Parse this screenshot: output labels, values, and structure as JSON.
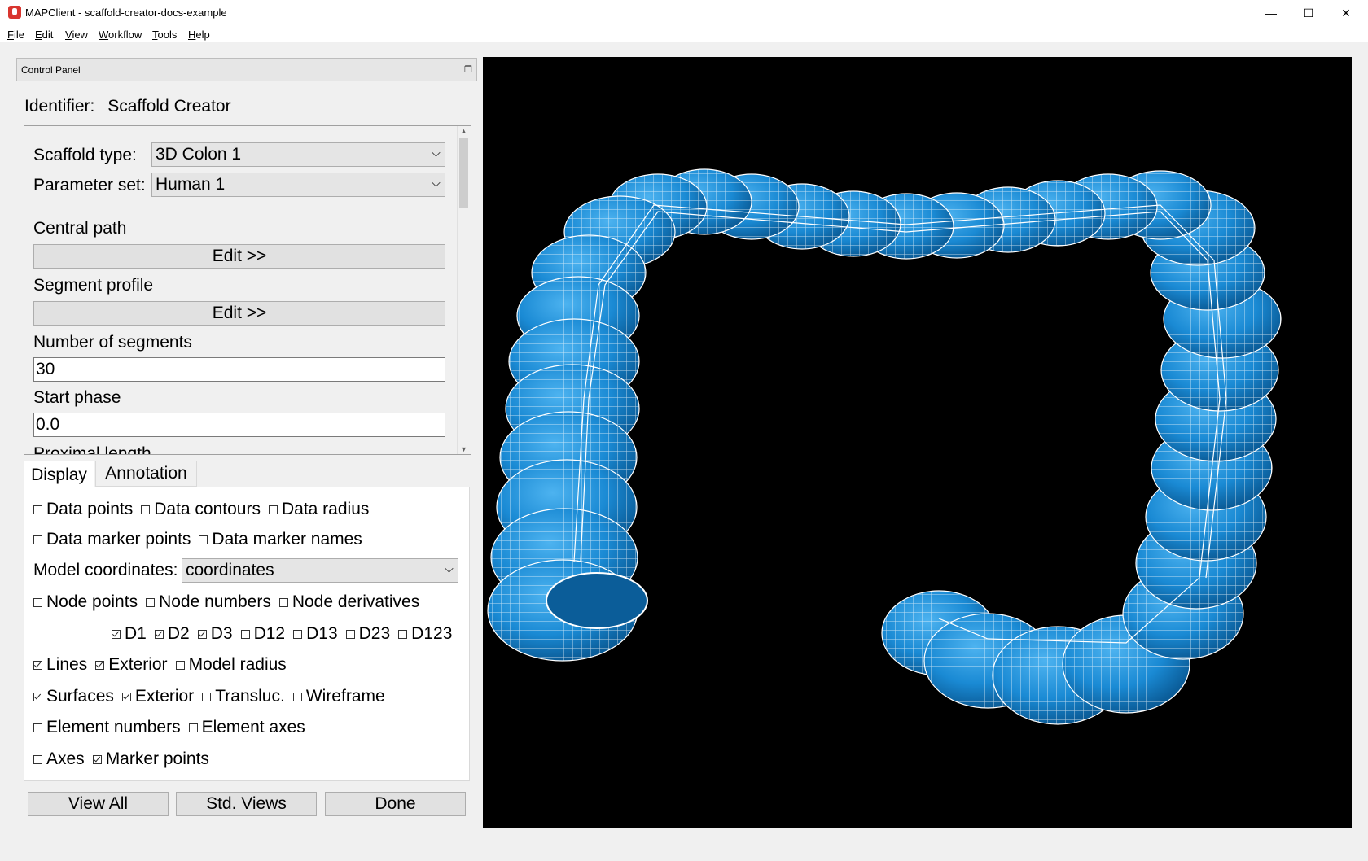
{
  "window": {
    "title": "MAPClient - scaffold-creator-docs-example",
    "minimize": "—",
    "maximize": "☐",
    "close": "✕"
  },
  "menubar": {
    "items": [
      "File",
      "Edit",
      "View",
      "Workflow",
      "Tools",
      "Help"
    ]
  },
  "control_panel": {
    "title": "Control Panel",
    "identifier_label": "Identifier:",
    "identifier_value": "Scaffold Creator",
    "scaffold_type_label": "Scaffold type:",
    "scaffold_type_value": "3D Colon 1",
    "parameter_set_label": "Parameter set:",
    "parameter_set_value": "Human 1",
    "central_path_label": "Central path",
    "central_path_button": "Edit >>",
    "segment_profile_label": "Segment profile",
    "segment_profile_button": "Edit >>",
    "num_segments_label": "Number of segments",
    "num_segments_value": "30",
    "start_phase_label": "Start phase",
    "start_phase_value": "0.0",
    "proximal_length_label": "Proximal length"
  },
  "tabs": {
    "display": "Display",
    "annotation": "Annotation"
  },
  "display": {
    "data_points": "Data points",
    "data_contours": "Data contours",
    "data_radius": "Data radius",
    "data_marker_points": "Data marker points",
    "data_marker_names": "Data marker names",
    "model_coordinates_label": "Model coordinates:",
    "model_coordinates_value": "coordinates",
    "node_points": "Node points",
    "node_numbers": "Node numbers",
    "node_derivatives": "Node derivatives",
    "d1": "D1",
    "d2": "D2",
    "d3": "D3",
    "d12": "D12",
    "d13": "D13",
    "d23": "D23",
    "d123": "D123",
    "lines": "Lines",
    "lines_exterior": "Exterior",
    "model_radius": "Model radius",
    "surfaces": "Surfaces",
    "surfaces_exterior": "Exterior",
    "transluc": "Transluc.",
    "wireframe": "Wireframe",
    "element_numbers": "Element numbers",
    "element_axes": "Element axes",
    "axes": "Axes",
    "marker_points": "Marker points"
  },
  "buttons": {
    "view_all": "View All",
    "std_views": "Std. Views",
    "done": "Done"
  },
  "colors": {
    "mesh_surface": "#1a8ad4",
    "mesh_lines": "#ffffff",
    "viewport_bg": "#000000"
  }
}
